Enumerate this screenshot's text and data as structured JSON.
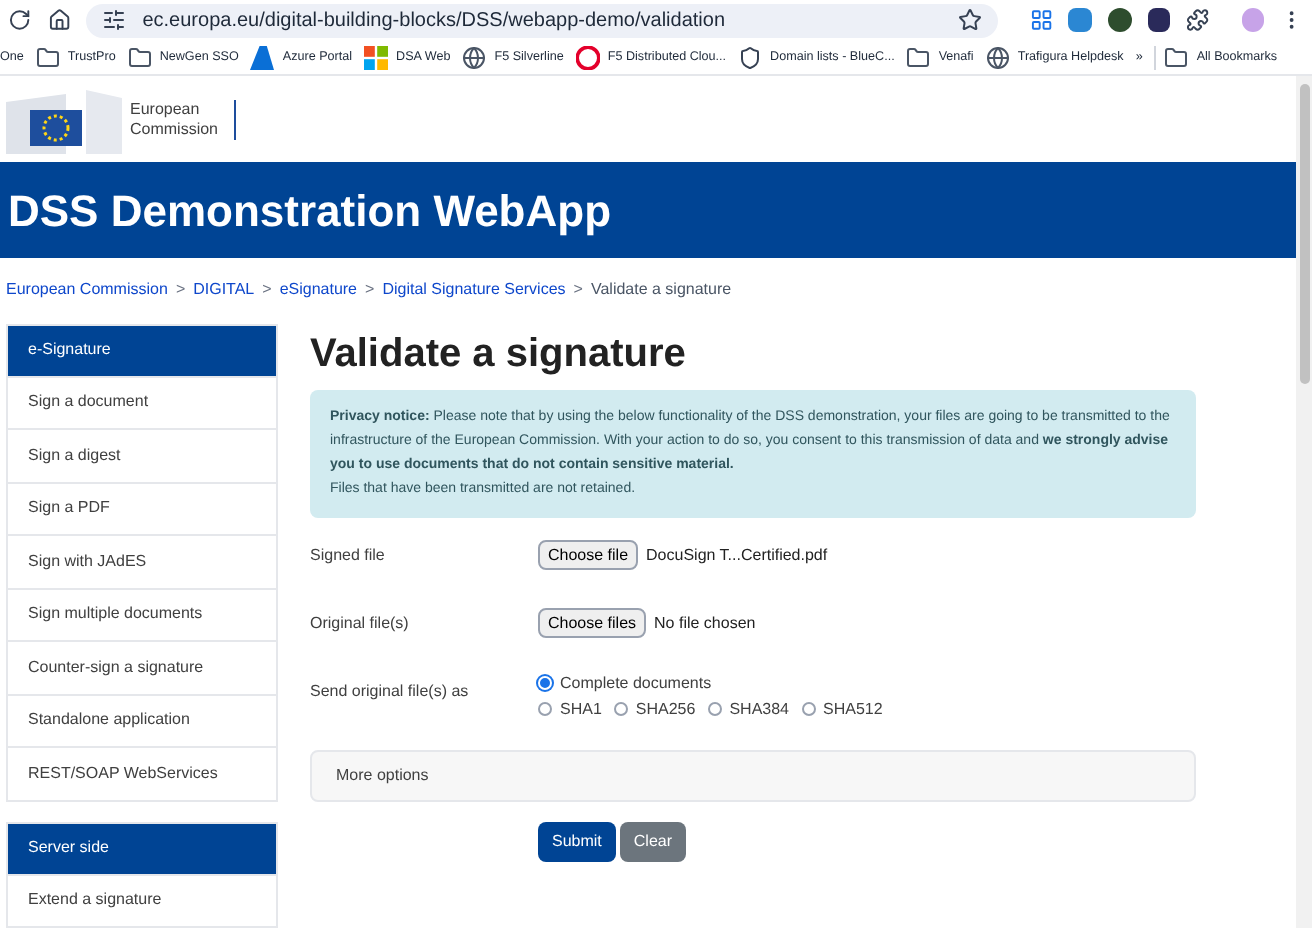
{
  "browser": {
    "url": "ec.europa.eu/digital-building-blocks/DSS/webapp-demo/validation",
    "bookmarks": [
      {
        "label": "One",
        "kind": "text"
      },
      {
        "label": "TrustPro",
        "kind": "folder"
      },
      {
        "label": "NewGen SSO",
        "kind": "folder"
      },
      {
        "label": "Azure Portal",
        "kind": "azure"
      },
      {
        "label": "DSA Web",
        "kind": "grid"
      },
      {
        "label": "F5 Silverline",
        "kind": "globe"
      },
      {
        "label": "F5 Distributed Clou...",
        "kind": "f5"
      },
      {
        "label": "Domain lists - BlueC...",
        "kind": "shield"
      },
      {
        "label": "Venafi",
        "kind": "folder"
      },
      {
        "label": "Trafigura Helpdesk",
        "kind": "globe"
      }
    ],
    "more": "»",
    "all_bookmarks": "All Bookmarks"
  },
  "logo": {
    "line1": "European",
    "line2": "Commission"
  },
  "banner": {
    "title": "DSS Demonstration WebApp"
  },
  "breadcrumb": [
    {
      "label": "European Commission",
      "link": true
    },
    {
      "label": "DIGITAL",
      "link": true
    },
    {
      "label": "eSignature",
      "link": true
    },
    {
      "label": "Digital Signature Services",
      "link": true
    },
    {
      "label": "Validate a signature",
      "link": false
    }
  ],
  "breadcrumb_separator": ">",
  "sidebar": [
    {
      "title": "e-Signature",
      "items": [
        "Sign a document",
        "Sign a digest",
        "Sign a PDF",
        "Sign with JAdES",
        "Sign multiple documents",
        "Counter-sign a signature",
        "Standalone application",
        "REST/SOAP WebServices"
      ]
    },
    {
      "title": "Server side",
      "items": [
        "Extend a signature"
      ]
    }
  ],
  "main": {
    "heading": "Validate a signature",
    "notice": [
      "**Privacy notice:** Please note that by using the below functionality of the DSS demonstration, your files are going to be transmitted to the infrastructure of the European Commission. With your action to do so, you consent to this transmission of data and **we strongly advise you to use documents that do not contain sensitive material.**",
      "Files that have been transmitted are not retained."
    ],
    "signed_file": {
      "label": "Signed file",
      "button": "Choose file",
      "value": "DocuSign T...Certified.pdf"
    },
    "original_files": {
      "label": "Original file(s)",
      "button": "Choose files",
      "value": "No file chosen"
    },
    "send_as": {
      "label": "Send original file(s) as",
      "options": [
        {
          "label": "Complete documents",
          "selected": true
        },
        {
          "label": "SHA1",
          "selected": false
        },
        {
          "label": "SHA256",
          "selected": false
        },
        {
          "label": "SHA384",
          "selected": false
        },
        {
          "label": "SHA512",
          "selected": false
        }
      ]
    },
    "more_options": "More options",
    "buttons": [
      {
        "label": "Submit",
        "kind": "primary"
      },
      {
        "label": "Clear",
        "kind": "secondary"
      }
    ]
  }
}
